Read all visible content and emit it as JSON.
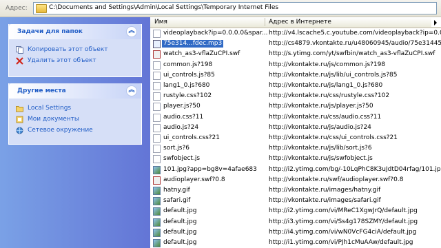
{
  "address": {
    "label": "Адрес:",
    "path": "C:\\Documents and Settings\\Admin\\Local Settings\\Temporary Internet Files"
  },
  "tasks_panel": {
    "title": "Задачи для папок",
    "items": [
      {
        "label": "Копировать этот объект",
        "icon": "copy-icon"
      },
      {
        "label": "Удалить этот объект",
        "icon": "delete-icon"
      }
    ]
  },
  "places_panel": {
    "title": "Другие места",
    "items": [
      {
        "label": "Local Settings",
        "icon": "folder-icon"
      },
      {
        "label": "Мои документы",
        "icon": "documents-icon"
      },
      {
        "label": "Сетевое окружение",
        "icon": "network-icon"
      }
    ]
  },
  "list": {
    "columns": {
      "name": "Имя",
      "url": "Адрес в Интернете"
    },
    "rows": [
      {
        "name": "videoplayback?ip=0.0.0.0&spar...",
        "url": "http://v4.lscache5.c.youtube.com/videoplayback?ip=0.0.0",
        "icon": "file",
        "selected": false
      },
      {
        "name": "75e314...fdec.mp3",
        "url": "http://cs4879.vkontakte.ru/u48060945/audio/75e31445fd",
        "icon": "mp3",
        "selected": true
      },
      {
        "name": "watch_as3-vflaZuCPI.swf",
        "url": "http://s.ytimg.com/yt/swfbin/watch_as3-vflaZuCPI.swf",
        "icon": "swf",
        "selected": false
      },
      {
        "name": "common.js?198",
        "url": "http://vkontakte.ru/js/common.js?198",
        "icon": "file",
        "selected": false
      },
      {
        "name": "ui_controls.js?85",
        "url": "http://vkontakte.ru/js/lib/ui_controls.js?85",
        "icon": "file",
        "selected": false
      },
      {
        "name": "lang1_0.js?680",
        "url": "http://vkontakte.ru/js/lang1_0.js?680",
        "icon": "file",
        "selected": false
      },
      {
        "name": "rustyle.css?102",
        "url": "http://vkontakte.ru/css/rustyle.css?102",
        "icon": "file",
        "selected": false
      },
      {
        "name": "player.js?50",
        "url": "http://vkontakte.ru/js/player.js?50",
        "icon": "file",
        "selected": false
      },
      {
        "name": "audio.css?11",
        "url": "http://vkontakte.ru/css/audio.css?11",
        "icon": "file",
        "selected": false
      },
      {
        "name": "audio.js?24",
        "url": "http://vkontakte.ru/js/audio.js?24",
        "icon": "file",
        "selected": false
      },
      {
        "name": "ui_controls.css?21",
        "url": "http://vkontakte.ru/css/ui_controls.css?21",
        "icon": "file",
        "selected": false
      },
      {
        "name": "sort.js?6",
        "url": "http://vkontakte.ru/js/lib/sort.js?6",
        "icon": "file",
        "selected": false
      },
      {
        "name": "swfobject.js",
        "url": "http://vkontakte.ru/js/swfobject.js",
        "icon": "file",
        "selected": false
      },
      {
        "name": "101.jpg?app=bg8v=4afae683",
        "url": "http://i2.ytimg.com/bg/-10LqPhC8K3uJdtD04rfag/101.jpg",
        "icon": "img",
        "selected": false
      },
      {
        "name": "audioplayer.swf?0.8",
        "url": "http://vkontakte.ru/swf/audioplayer.swf?0.8",
        "icon": "swf",
        "selected": false
      },
      {
        "name": "hatny.gif",
        "url": "http://vkontakte.ru/images/hatny.gif",
        "icon": "img",
        "selected": false
      },
      {
        "name": "safari.gif",
        "url": "http://vkontakte.ru/images/safari.gif",
        "icon": "img",
        "selected": false
      },
      {
        "name": "default.jpg",
        "url": "http://i2.ytimg.com/vi/MReC1XgwJrQ/default.jpg",
        "icon": "img",
        "selected": false
      },
      {
        "name": "default.jpg",
        "url": "http://i3.ytimg.com/vi/Ss4g178SZMY/default.jpg",
        "icon": "img",
        "selected": false
      },
      {
        "name": "default.jpg",
        "url": "http://i4.ytimg.com/vi/wN0VcFG4ciA/default.jpg",
        "icon": "img",
        "selected": false
      },
      {
        "name": "default.jpg",
        "url": "http://i1.ytimg.com/vi/PJh1cMuAAw/default.jpg",
        "icon": "img",
        "selected": false
      }
    ]
  }
}
